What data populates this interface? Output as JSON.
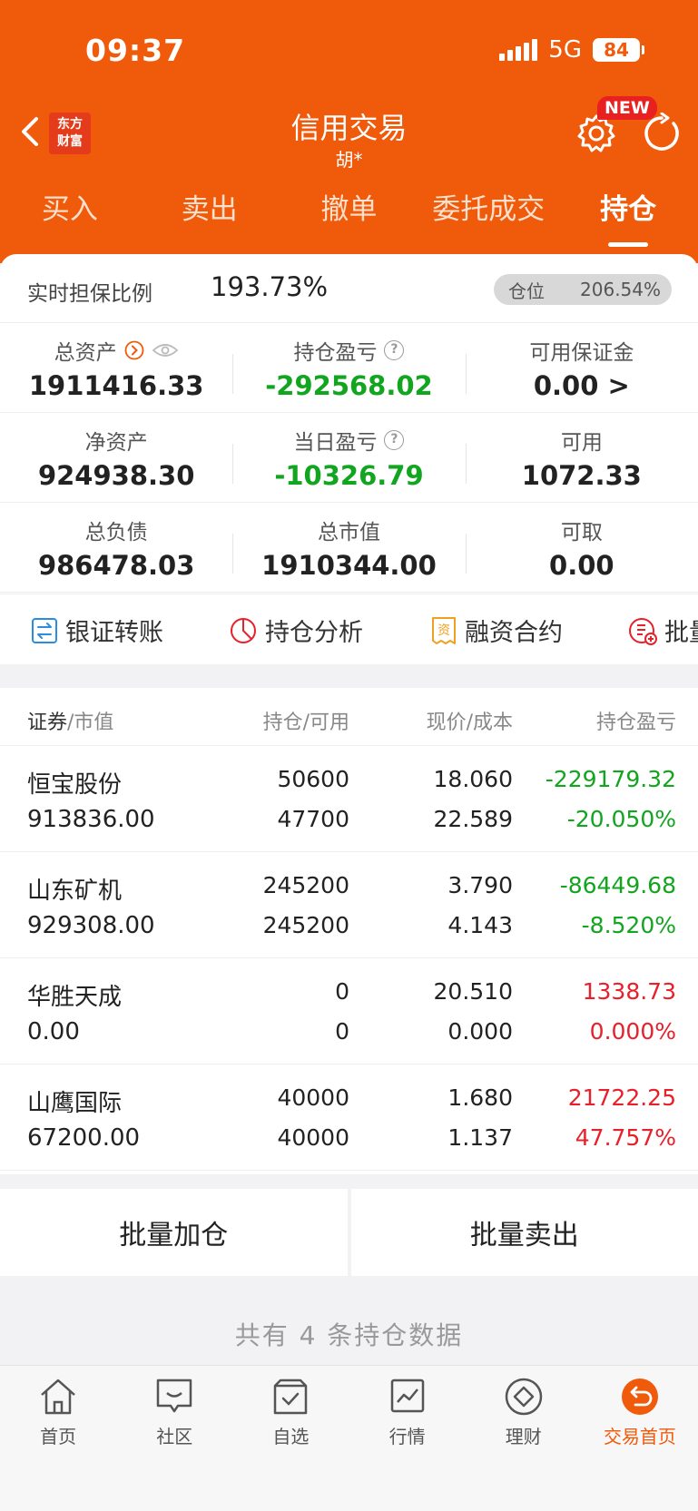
{
  "status_bar": {
    "time": "09:37",
    "network": "5G",
    "battery": "84"
  },
  "header": {
    "logo_line1": "东方",
    "logo_line2": "财富",
    "title": "信用交易",
    "subtitle": "胡*",
    "new_badge": "NEW"
  },
  "tabs": [
    {
      "label": "买入"
    },
    {
      "label": "卖出"
    },
    {
      "label": "撤单"
    },
    {
      "label": "委托成交"
    },
    {
      "label": "持仓"
    }
  ],
  "summary": {
    "ratio_label": "实时担保比例",
    "ratio_value": "193.73%",
    "position_label": "仓位",
    "position_value": "206.54%",
    "total_assets_label": "总资产",
    "total_assets": "1911416.33",
    "holding_pnl_label": "持仓盈亏",
    "holding_pnl": "-292568.02",
    "available_margin_label": "可用保证金",
    "available_margin": "0.00 >",
    "net_assets_label": "净资产",
    "net_assets": "924938.30",
    "daily_pnl_label": "当日盈亏",
    "daily_pnl": "-10326.79",
    "available_label": "可用",
    "available": "1072.33",
    "total_liabilities_label": "总负债",
    "total_liabilities": "986478.03",
    "market_value_label": "总市值",
    "market_value": "1910344.00",
    "withdrawable_label": "可取",
    "withdrawable": "0.00"
  },
  "tools": [
    {
      "label": "银证转账"
    },
    {
      "label": "持仓分析"
    },
    {
      "label": "融资合约"
    },
    {
      "label": "批量"
    }
  ],
  "table_header": {
    "col1a": "证券",
    "col1b": "/市值",
    "col2a": "持仓",
    "col2b": "/可用",
    "col3a": "现价",
    "col3b": "/成本",
    "col4": "持仓盈亏"
  },
  "holdings": [
    {
      "name": "恒宝股份",
      "market_value": "913836.00",
      "position": "50600",
      "available": "47700",
      "price": "18.060",
      "cost": "22.589",
      "pnl": "-229179.32",
      "pnl_pct": "-20.050%",
      "color": "#12a51f"
    },
    {
      "name": "山东矿机",
      "market_value": "929308.00",
      "position": "245200",
      "available": "245200",
      "price": "3.790",
      "cost": "4.143",
      "pnl": "-86449.68",
      "pnl_pct": "-8.520%",
      "color": "#12a51f"
    },
    {
      "name": "华胜天成",
      "market_value": "0.00",
      "position": "0",
      "available": "0",
      "price": "20.510",
      "cost": "0.000",
      "pnl": "1338.73",
      "pnl_pct": "0.000%",
      "color": "#e8202a"
    },
    {
      "name": "山鹰国际",
      "market_value": "67200.00",
      "position": "40000",
      "available": "40000",
      "price": "1.680",
      "cost": "1.137",
      "pnl": "21722.25",
      "pnl_pct": "47.757%",
      "color": "#e8202a"
    }
  ],
  "batch": {
    "add": "批量加仓",
    "sell": "批量卖出"
  },
  "footer_summary": "共有 4 条持仓数据",
  "bottom_nav": [
    {
      "label": "首页",
      "icon": "home-icon"
    },
    {
      "label": "社区",
      "icon": "chat-icon"
    },
    {
      "label": "自选",
      "icon": "watchlist-icon"
    },
    {
      "label": "行情",
      "icon": "chart-icon"
    },
    {
      "label": "理财",
      "icon": "diamond-icon"
    },
    {
      "label": "交易首页",
      "icon": "trade-icon"
    }
  ],
  "colors": {
    "brand": "#ef5a0b",
    "gain": "#e8202a",
    "loss": "#12a51f"
  }
}
